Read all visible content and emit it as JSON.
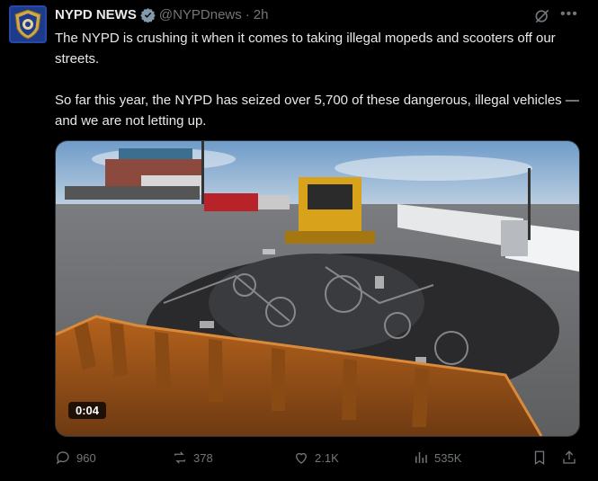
{
  "author": {
    "display_name": "NYPD NEWS",
    "handle": "@NYPDnews",
    "separator": "·",
    "time": "2h",
    "avatar_icon": "nypd-shield-icon",
    "verified_icon": "verified-badge-icon"
  },
  "tweet": {
    "paragraph1": "The NYPD is crushing it when it comes to taking illegal mopeds and scooters off our streets.",
    "paragraph2": "So far this year, the NYPD has seized over 5,700 of these dangerous, illegal vehicles — and we are not letting up."
  },
  "media": {
    "video_timestamp": "0:04",
    "description_icon": "video-thumbnail"
  },
  "actions": {
    "replies": "960",
    "reposts": "378",
    "likes": "2.1K",
    "views": "535K"
  },
  "colors": {
    "background": "#000000",
    "text": "#e7e9ea",
    "muted": "#71767b",
    "verified": "#1d9bf0"
  }
}
